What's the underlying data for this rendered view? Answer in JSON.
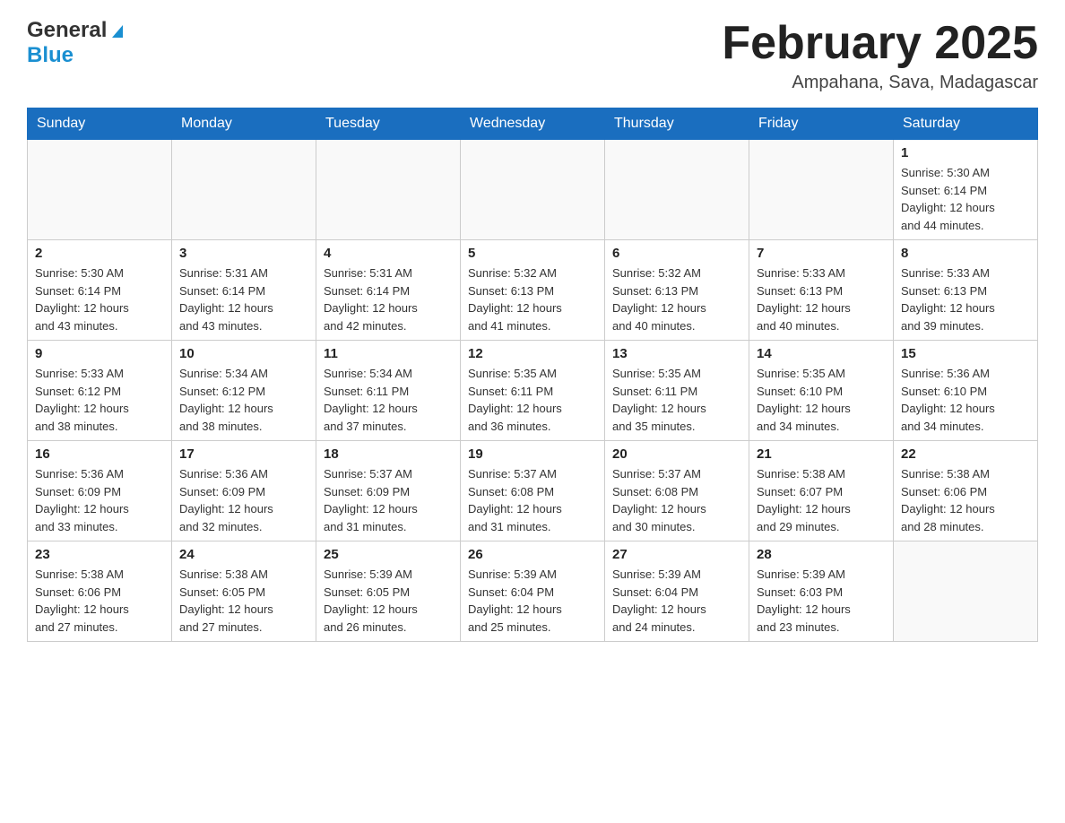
{
  "header": {
    "logo_general": "General",
    "logo_blue": "Blue",
    "month_title": "February 2025",
    "location": "Ampahana, Sava, Madagascar"
  },
  "days_of_week": [
    "Sunday",
    "Monday",
    "Tuesday",
    "Wednesday",
    "Thursday",
    "Friday",
    "Saturday"
  ],
  "weeks": [
    [
      {
        "day": "",
        "info": ""
      },
      {
        "day": "",
        "info": ""
      },
      {
        "day": "",
        "info": ""
      },
      {
        "day": "",
        "info": ""
      },
      {
        "day": "",
        "info": ""
      },
      {
        "day": "",
        "info": ""
      },
      {
        "day": "1",
        "info": "Sunrise: 5:30 AM\nSunset: 6:14 PM\nDaylight: 12 hours\nand 44 minutes."
      }
    ],
    [
      {
        "day": "2",
        "info": "Sunrise: 5:30 AM\nSunset: 6:14 PM\nDaylight: 12 hours\nand 43 minutes."
      },
      {
        "day": "3",
        "info": "Sunrise: 5:31 AM\nSunset: 6:14 PM\nDaylight: 12 hours\nand 43 minutes."
      },
      {
        "day": "4",
        "info": "Sunrise: 5:31 AM\nSunset: 6:14 PM\nDaylight: 12 hours\nand 42 minutes."
      },
      {
        "day": "5",
        "info": "Sunrise: 5:32 AM\nSunset: 6:13 PM\nDaylight: 12 hours\nand 41 minutes."
      },
      {
        "day": "6",
        "info": "Sunrise: 5:32 AM\nSunset: 6:13 PM\nDaylight: 12 hours\nand 40 minutes."
      },
      {
        "day": "7",
        "info": "Sunrise: 5:33 AM\nSunset: 6:13 PM\nDaylight: 12 hours\nand 40 minutes."
      },
      {
        "day": "8",
        "info": "Sunrise: 5:33 AM\nSunset: 6:13 PM\nDaylight: 12 hours\nand 39 minutes."
      }
    ],
    [
      {
        "day": "9",
        "info": "Sunrise: 5:33 AM\nSunset: 6:12 PM\nDaylight: 12 hours\nand 38 minutes."
      },
      {
        "day": "10",
        "info": "Sunrise: 5:34 AM\nSunset: 6:12 PM\nDaylight: 12 hours\nand 38 minutes."
      },
      {
        "day": "11",
        "info": "Sunrise: 5:34 AM\nSunset: 6:11 PM\nDaylight: 12 hours\nand 37 minutes."
      },
      {
        "day": "12",
        "info": "Sunrise: 5:35 AM\nSunset: 6:11 PM\nDaylight: 12 hours\nand 36 minutes."
      },
      {
        "day": "13",
        "info": "Sunrise: 5:35 AM\nSunset: 6:11 PM\nDaylight: 12 hours\nand 35 minutes."
      },
      {
        "day": "14",
        "info": "Sunrise: 5:35 AM\nSunset: 6:10 PM\nDaylight: 12 hours\nand 34 minutes."
      },
      {
        "day": "15",
        "info": "Sunrise: 5:36 AM\nSunset: 6:10 PM\nDaylight: 12 hours\nand 34 minutes."
      }
    ],
    [
      {
        "day": "16",
        "info": "Sunrise: 5:36 AM\nSunset: 6:09 PM\nDaylight: 12 hours\nand 33 minutes."
      },
      {
        "day": "17",
        "info": "Sunrise: 5:36 AM\nSunset: 6:09 PM\nDaylight: 12 hours\nand 32 minutes."
      },
      {
        "day": "18",
        "info": "Sunrise: 5:37 AM\nSunset: 6:09 PM\nDaylight: 12 hours\nand 31 minutes."
      },
      {
        "day": "19",
        "info": "Sunrise: 5:37 AM\nSunset: 6:08 PM\nDaylight: 12 hours\nand 31 minutes."
      },
      {
        "day": "20",
        "info": "Sunrise: 5:37 AM\nSunset: 6:08 PM\nDaylight: 12 hours\nand 30 minutes."
      },
      {
        "day": "21",
        "info": "Sunrise: 5:38 AM\nSunset: 6:07 PM\nDaylight: 12 hours\nand 29 minutes."
      },
      {
        "day": "22",
        "info": "Sunrise: 5:38 AM\nSunset: 6:06 PM\nDaylight: 12 hours\nand 28 minutes."
      }
    ],
    [
      {
        "day": "23",
        "info": "Sunrise: 5:38 AM\nSunset: 6:06 PM\nDaylight: 12 hours\nand 27 minutes."
      },
      {
        "day": "24",
        "info": "Sunrise: 5:38 AM\nSunset: 6:05 PM\nDaylight: 12 hours\nand 27 minutes."
      },
      {
        "day": "25",
        "info": "Sunrise: 5:39 AM\nSunset: 6:05 PM\nDaylight: 12 hours\nand 26 minutes."
      },
      {
        "day": "26",
        "info": "Sunrise: 5:39 AM\nSunset: 6:04 PM\nDaylight: 12 hours\nand 25 minutes."
      },
      {
        "day": "27",
        "info": "Sunrise: 5:39 AM\nSunset: 6:04 PM\nDaylight: 12 hours\nand 24 minutes."
      },
      {
        "day": "28",
        "info": "Sunrise: 5:39 AM\nSunset: 6:03 PM\nDaylight: 12 hours\nand 23 minutes."
      },
      {
        "day": "",
        "info": ""
      }
    ]
  ]
}
